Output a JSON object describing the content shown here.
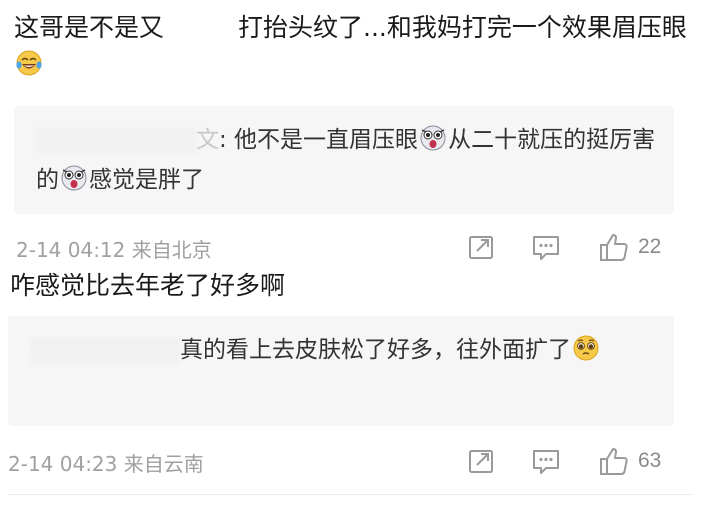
{
  "comments": [
    {
      "text_before": "这哥是不是又",
      "text_after": "打抬头纹了...和我妈打完一个效果眉压眼",
      "emoji": "laughing-tears-emoji",
      "reply": {
        "user_suffix": "文",
        "text_part1": ": 他不是一直眉压眼",
        "text_part2": "从二十就压的挺厉害的",
        "text_part3": "感觉是胖了"
      },
      "timestamp": "2-14 04:12 来自北京",
      "like_count": "22"
    },
    {
      "text": "咋感觉比去年老了好多啊",
      "reply": {
        "text": "真的看上去皮肤松了好多，往外面扩了"
      },
      "timestamp": "2-14 04:23 来自云南",
      "like_count": "63"
    }
  ],
  "colors": {
    "reply_bg": "#f6f6f6",
    "meta_text": "#a0a0a0",
    "icon": "#9a9a9a"
  },
  "icons": [
    "share-icon",
    "comment-icon",
    "like-icon",
    "shocked-emoji",
    "pleading-emoji",
    "laughing-tears-emoji"
  ]
}
